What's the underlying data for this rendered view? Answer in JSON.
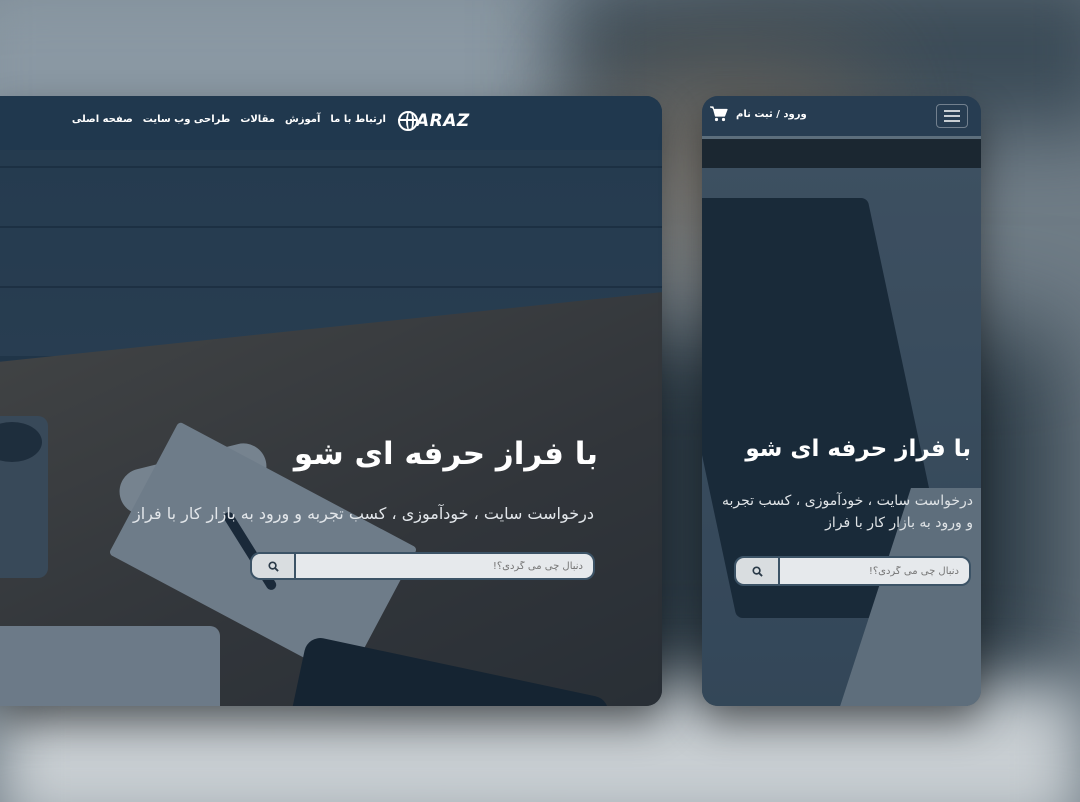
{
  "brand": {
    "logo_text": "ARAZ",
    "logo_icon": "globe-f-icon"
  },
  "desktop": {
    "nav": {
      "items": [
        {
          "label": "صفحه اصلی"
        },
        {
          "label": "طراحی وب سایت"
        },
        {
          "label": "مقالات"
        },
        {
          "label": "آموزش"
        },
        {
          "label": "ارتباط با ما"
        }
      ]
    },
    "hero": {
      "title": "با فراز حرفه ای شو",
      "subtitle": "درخواست سایت ، خودآموزی ، کسب تجربه و ورود به بازار کار با فراز"
    },
    "search": {
      "placeholder": "دنبال چی می گردی؟!",
      "button_icon": "search-icon"
    }
  },
  "mobile": {
    "nav": {
      "login_label": "ورود / ثبت نام",
      "cart_icon": "cart-icon",
      "menu_icon": "hamburger-icon"
    },
    "hero": {
      "title": "با فراز حرفه ای شو",
      "subtitle": "درخواست سایت ، خودآموزی ، کسب تجربه و ورود به بازار کار با فراز"
    },
    "search": {
      "placeholder": "دنبال چی می گردی؟!",
      "button_icon": "search-icon"
    }
  },
  "colors": {
    "overlay": "#162c42",
    "nav": "#1e374e",
    "accent": "#ffffff"
  }
}
